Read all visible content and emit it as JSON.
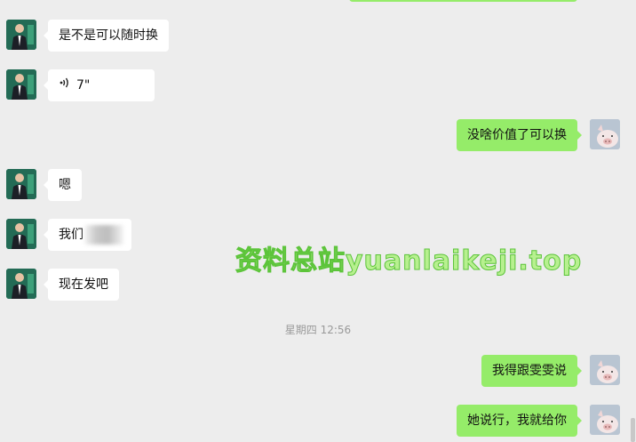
{
  "messages": [
    {
      "side": "left",
      "text": "是不是可以随时换"
    },
    {
      "side": "left",
      "type": "voice",
      "duration": "7\""
    },
    {
      "side": "right",
      "text": "没啥价值了可以换"
    },
    {
      "side": "left",
      "text": "嗯"
    },
    {
      "side": "left",
      "text": "我们"
    },
    {
      "side": "left",
      "text": "现在发吧"
    },
    {
      "side": "right",
      "text": "我得跟雯雯说"
    },
    {
      "side": "right",
      "text": "她说行，我就给你"
    }
  ],
  "timestamp": "星期四 12:56",
  "watermark": "资料总站yuanlaikeji.top",
  "colors": {
    "background": "#ededed",
    "sent_bubble": "#95ec69",
    "received_bubble": "#ffffff",
    "watermark": "#b7f08f"
  },
  "icons": {
    "voice": "voice-wave-icon",
    "contact_avatar": "man-in-suit-avatar",
    "self_avatar": "pig-avatar"
  }
}
